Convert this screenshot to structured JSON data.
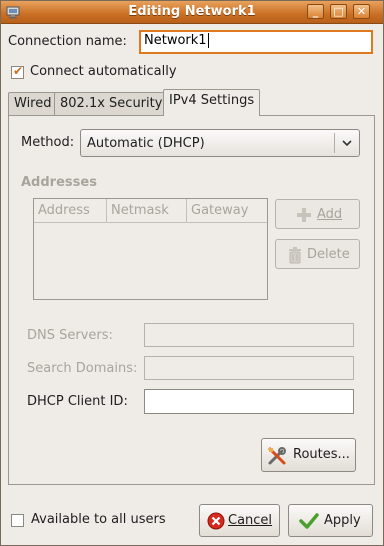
{
  "window": {
    "title": "Editing Network1",
    "buttons": {
      "minimize": "_",
      "maximize": "□",
      "close": "✕"
    }
  },
  "connection_name": {
    "label": "Connection name:",
    "value": "Network1"
  },
  "connect_automatically": {
    "label": "Connect automatically",
    "checked": true
  },
  "tabs": [
    {
      "label": "Wired",
      "active": false
    },
    {
      "label": "802.1x Security",
      "active": false
    },
    {
      "label": "IPv4 Settings",
      "active": true
    }
  ],
  "ipv4": {
    "method_label": "Method:",
    "method_value": "Automatic (DHCP)",
    "addresses_heading": "Addresses",
    "columns": [
      "Address",
      "Netmask",
      "Gateway"
    ],
    "add_label": "Add",
    "delete_label": "Delete",
    "dns_servers_label": "DNS Servers:",
    "dns_servers_value": "",
    "search_domains_label": "Search Domains:",
    "search_domains_value": "",
    "dhcp_client_id_label": "DHCP Client ID:",
    "dhcp_client_id_value": "",
    "routes_label": "Routes..."
  },
  "footer": {
    "available_label": "Available to all users",
    "available_checked": false,
    "cancel_label": "Cancel",
    "apply_label": "Apply"
  },
  "colors": {
    "titlebar": "#c96f25",
    "window_bg": "#efebe7",
    "focus_ring": "#e07a1f",
    "disabled_text": "#a9a49c"
  }
}
